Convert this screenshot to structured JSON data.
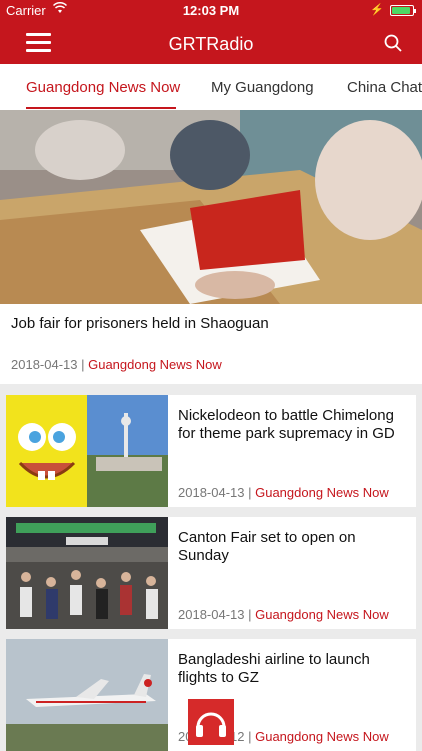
{
  "status": {
    "carrier": "Carrier",
    "time": "12:03 PM",
    "battery_level": 0.9
  },
  "header": {
    "title": "GRTRadio"
  },
  "tabs": [
    {
      "label": "Guangdong News Now"
    },
    {
      "label": "My Guangdong"
    },
    {
      "label": "China Chats"
    }
  ],
  "hero": {
    "title": "Job fair for prisoners held in Shaoguan",
    "date": "2018-04-13",
    "category": "Guangdong News Now"
  },
  "articles": [
    {
      "title": "Nickelodeon to battle Chimelong for theme park supremacy in GD",
      "date": "2018-04-13",
      "category": "Guangdong News Now"
    },
    {
      "title": "Canton Fair set to open on Sunday",
      "date": "2018-04-13",
      "category": "Guangdong News Now"
    },
    {
      "title": "Bangladeshi airline to launch flights to GZ",
      "date": "2018-04-12",
      "category": "Guangdong News Now"
    }
  ],
  "colors": {
    "brand": "#c5161d",
    "category": "#c5161d"
  },
  "icons": {
    "menu": "hamburger-icon",
    "search": "search-icon",
    "player": "headphone-icon"
  }
}
